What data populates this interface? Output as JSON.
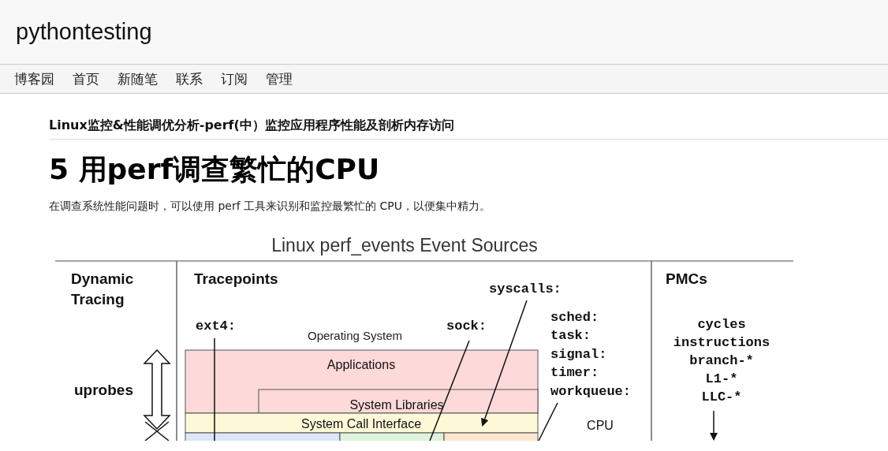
{
  "blog_title": "pythontesting",
  "nav": [
    "博客园",
    "首页",
    "新随笔",
    "联系",
    "订阅",
    "管理"
  ],
  "post_title": "Linux监控&性能调优分析-perf(中）监控应用程序性能及剖析内存访问",
  "heading": "5 用perf调查繁忙的CPU",
  "intro": "在调查系统性能问题时，可以使用 perf 工具来识别和监控最繁忙的 CPU，以便集中精力。",
  "figure": {
    "title": "Linux perf_events Event Sources",
    "sections": [
      [
        "Dynamic",
        "Tracing"
      ],
      [
        "Tracepoints"
      ],
      [
        "PMCs"
      ]
    ],
    "dynamic_probe": "uprobes",
    "tracepoints": [
      "syscalls:",
      "sched:",
      "task:",
      "signal:",
      "timer:",
      "workqueue:",
      "sock:",
      "ext4:"
    ],
    "os_label": "Operating System",
    "layers": [
      "Applications",
      "System Libraries",
      "System Call Interface"
    ],
    "hw_label": "CPU",
    "pmc_events": [
      "cycles",
      "instructions",
      "branch-*",
      "L1-*",
      "LLC-*"
    ]
  }
}
